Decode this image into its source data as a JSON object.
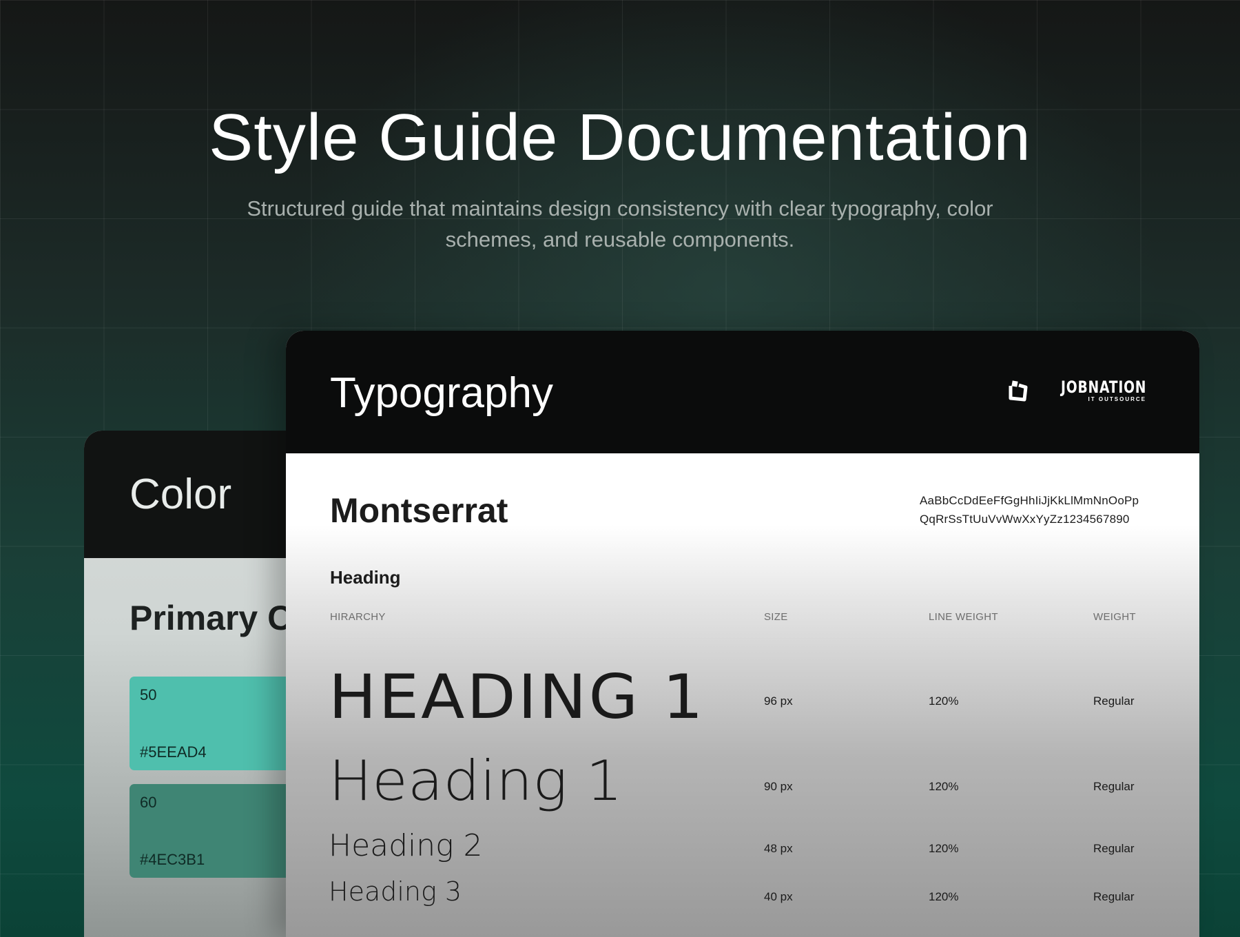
{
  "hero": {
    "title": "Style Guide Documentation",
    "subtitle": "Structured guide that maintains design consistency with clear typography, color schemes, and reusable components."
  },
  "color_card": {
    "title": "Color",
    "subtitle": "Primary C",
    "swatches": [
      {
        "step": "50",
        "hex": "#5EEAD4",
        "fill": "#4fbfad"
      },
      {
        "step": "60",
        "hex": "#4EC3B1",
        "fill": "#3f8574"
      }
    ]
  },
  "typography_card": {
    "title": "Typography",
    "logo": {
      "name": "JOBNATION",
      "tagline": "IT OUTSOURCE",
      "icon": "jobnation-logo-icon"
    },
    "font_name": "Montserrat",
    "alphabet_line1": "AaBbCcDdEeFfGgHhIiJjKkLlMmNnOoPp",
    "alphabet_line2": "QqRrSsTtUuVvWwXxYyZz1234567890",
    "section": "Heading",
    "columns": [
      "HIRARCHY",
      "SIZE",
      "LINE WEIGHT",
      "WEIGHT"
    ],
    "rows": [
      {
        "sample": "HEADING 1",
        "size": "96 px",
        "line": "120%",
        "weight": "Regular"
      },
      {
        "sample": "Heading 1",
        "size": "90 px",
        "line": "120%",
        "weight": "Regular"
      },
      {
        "sample": "Heading 2",
        "size": "48 px",
        "line": "120%",
        "weight": "Regular"
      },
      {
        "sample": "Heading 3",
        "size": "40 px",
        "line": "120%",
        "weight": "Regular"
      }
    ]
  }
}
